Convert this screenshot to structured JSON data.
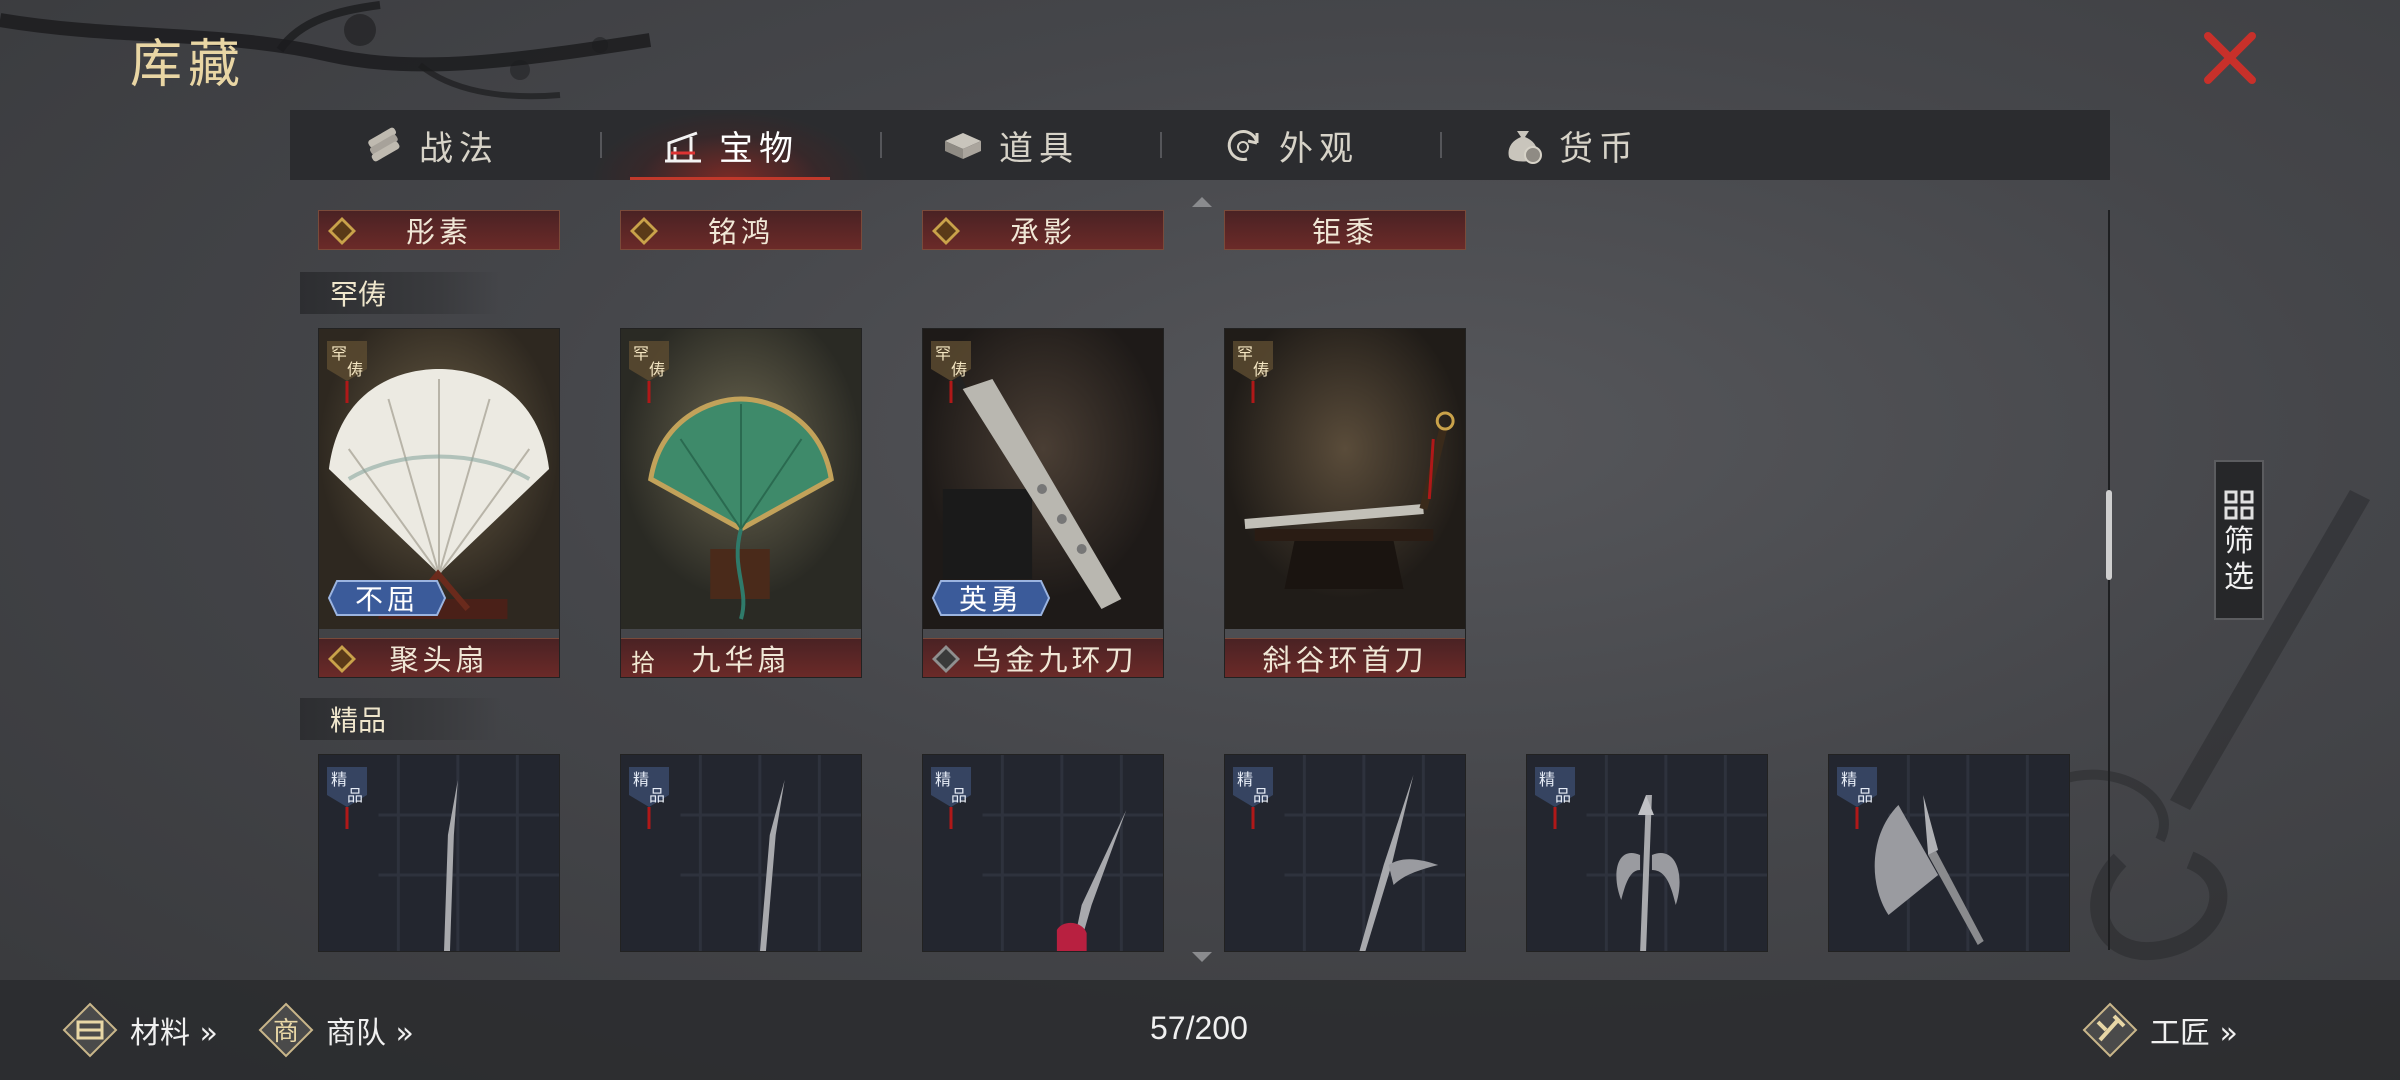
{
  "header": {
    "title": "库藏"
  },
  "tabs": [
    {
      "label": "战法",
      "icon": "scroll-bundle-icon",
      "active": false
    },
    {
      "label": "宝物",
      "icon": "weapon-rack-icon",
      "active": true
    },
    {
      "label": "道具",
      "icon": "chest-icon",
      "active": false
    },
    {
      "label": "外观",
      "icon": "swirl-icon",
      "active": false
    },
    {
      "label": "货币",
      "icon": "money-bag-icon",
      "active": false
    }
  ],
  "top_row": [
    {
      "name": "彤素",
      "quality": "極"
    },
    {
      "name": "铭鸿",
      "quality": "極"
    },
    {
      "name": "承影",
      "quality": "極"
    },
    {
      "name": "钜黍",
      "quality": ""
    }
  ],
  "sections": {
    "rare": {
      "label": "罕俦",
      "items": [
        {
          "name": "聚头扇",
          "quality": "極",
          "tag": "罕俦",
          "trait": "不屈"
        },
        {
          "name": "九华扇",
          "quality": "拾",
          "tag": "罕俦",
          "trait": ""
        },
        {
          "name": "乌金九环刀",
          "quality": "極",
          "tag": "罕俦",
          "trait": "英勇"
        },
        {
          "name": "斜谷环首刀",
          "quality": "",
          "tag": "罕俦",
          "trait": ""
        }
      ]
    },
    "fine": {
      "label": "精品",
      "items": [
        {
          "tag": "精品",
          "art": "spear-icon"
        },
        {
          "tag": "精品",
          "art": "spear-icon"
        },
        {
          "tag": "精品",
          "art": "red-tassel-spear-icon"
        },
        {
          "tag": "精品",
          "art": "halberd-icon"
        },
        {
          "tag": "精品",
          "art": "crescent-halberd-icon"
        },
        {
          "tag": "精品",
          "art": "axe-icon"
        }
      ]
    }
  },
  "filter": {
    "label": "筛选"
  },
  "bottom": {
    "materials": "材料 »",
    "caravan": "商队 »",
    "craftsman": "工匠 »",
    "count": "57/200"
  },
  "colors": {
    "accent_red": "#c0392b",
    "gold_text": "#e9d6a4",
    "namebar": "#6b2a28"
  }
}
